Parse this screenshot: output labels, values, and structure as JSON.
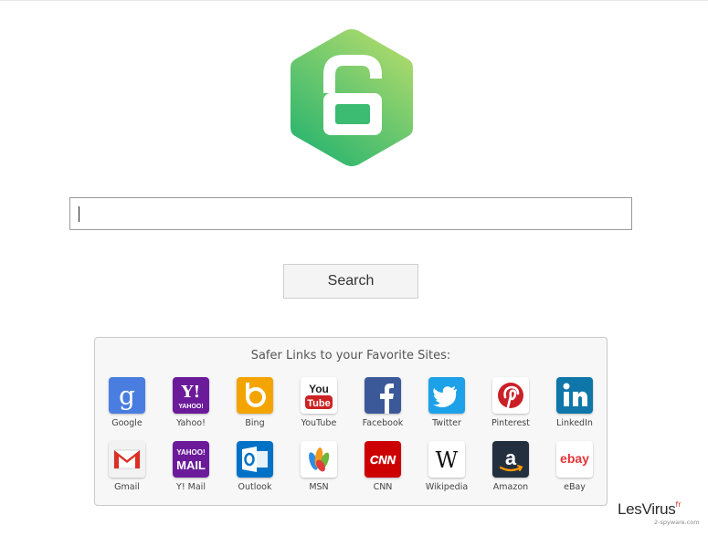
{
  "search": {
    "button_label": "Search",
    "input_value": ""
  },
  "panel": {
    "title": "Safer Links to your Favorite Sites:",
    "sites": [
      {
        "label": "Google",
        "icon": "google-icon",
        "color": "#4a7de0"
      },
      {
        "label": "Yahoo!",
        "icon": "yahoo-icon",
        "color": "#6b1b9a",
        "text": "YAHOO!"
      },
      {
        "label": "Bing",
        "icon": "bing-icon",
        "color": "#f4a400"
      },
      {
        "label": "YouTube",
        "icon": "youtube-icon",
        "color": "#cc2222",
        "text_top": "You",
        "text_bottom": "Tube"
      },
      {
        "label": "Facebook",
        "icon": "facebook-icon",
        "color": "#3b5998"
      },
      {
        "label": "Twitter",
        "icon": "twitter-icon",
        "color": "#1da1e8"
      },
      {
        "label": "Pinterest",
        "icon": "pinterest-icon",
        "color": "#cb2027"
      },
      {
        "label": "LinkedIn",
        "icon": "linkedin-icon",
        "color": "#0e76a8"
      },
      {
        "label": "Gmail",
        "icon": "gmail-icon",
        "color": "#d93025"
      },
      {
        "label": "Y! Mail",
        "icon": "ymail-icon",
        "color": "#6b1b9a",
        "text_top": "YAHOO!",
        "text_bottom": "MAIL"
      },
      {
        "label": "Outlook",
        "icon": "outlook-icon",
        "color": "#0072c6"
      },
      {
        "label": "MSN",
        "icon": "msn-icon",
        "color": "#ffffff"
      },
      {
        "label": "CNN",
        "icon": "cnn-icon",
        "color": "#cc0000",
        "text": "CNN"
      },
      {
        "label": "Wikipedia",
        "icon": "wikipedia-icon",
        "color": "#ffffff"
      },
      {
        "label": "Amazon",
        "icon": "amazon-icon",
        "color": "#232f3e"
      },
      {
        "label": "eBay",
        "icon": "ebay-icon",
        "color": "#ffffff",
        "text": "ebay"
      }
    ]
  },
  "watermark": {
    "main": "LesVirus",
    "sup": "fr",
    "sub": "2-spyware.com"
  },
  "colors": {
    "logo_light": "#a8d86a",
    "logo_dark": "#2fb86e"
  }
}
